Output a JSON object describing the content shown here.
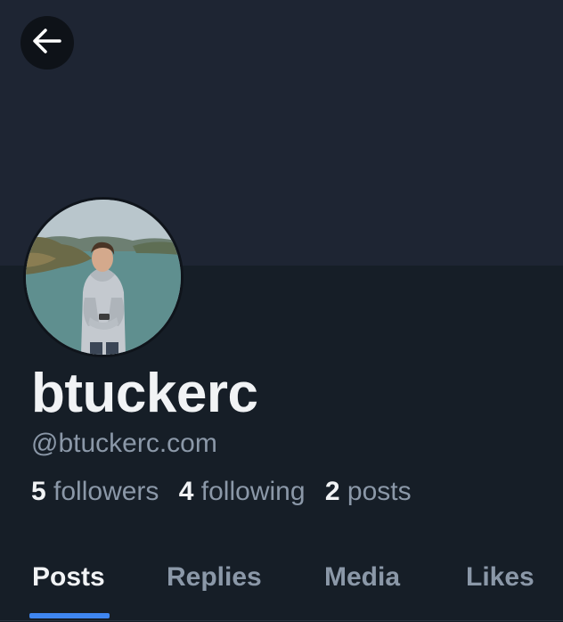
{
  "profile": {
    "display_name": "btuckerc",
    "handle": "@btuckerc.com",
    "stats": {
      "followers_count": "5",
      "followers_label": "followers",
      "following_count": "4",
      "following_label": "following",
      "posts_count": "2",
      "posts_label": "posts"
    }
  },
  "tabs": [
    {
      "label": "Posts",
      "active": true
    },
    {
      "label": "Replies",
      "active": false
    },
    {
      "label": "Media",
      "active": false
    },
    {
      "label": "Likes",
      "active": false
    }
  ],
  "icons": {
    "back": "arrow-left-icon"
  },
  "colors": {
    "banner": "#1e2533",
    "background": "#161e27",
    "accent": "#3f86f0",
    "text_primary": "#f1f3f5",
    "text_secondary": "#8b98a8"
  }
}
